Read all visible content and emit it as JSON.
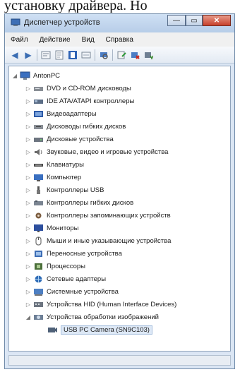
{
  "caption_fragment": "установку драйвера. Но",
  "window": {
    "title": "Диспетчер устройств",
    "controls": {
      "minimize": "—",
      "maximize": "▭",
      "close": "✕"
    }
  },
  "menu": [
    "Файл",
    "Действие",
    "Вид",
    "Справка"
  ],
  "toolbar": {
    "icons": [
      "back-arrow-icon",
      "forward-arrow-icon",
      "device-tree-icon",
      "properties-icon",
      "help-icon",
      "show-hidden-icon",
      "scan-hardware-icon",
      "update-driver-icon",
      "disable-device-icon",
      "uninstall-device-icon"
    ]
  },
  "tree": {
    "root": "AntonPC",
    "items": [
      "DVD и CD-ROM дисководы",
      "IDE ATA/ATAPI контроллеры",
      "Видеоадаптеры",
      "Дисководы гибких дисков",
      "Дисковые устройства",
      "Звуковые, видео и игровые устройства",
      "Клавиатуры",
      "Компьютер",
      "Контроллеры USB",
      "Контроллеры гибких дисков",
      "Контроллеры запоминающих устройств",
      "Мониторы",
      "Мыши и иные указывающие устройства",
      "Переносные устройства",
      "Процессоры",
      "Сетевые адаптеры",
      "Системные устройства",
      "Устройства HID (Human Interface Devices)",
      "Устройства обработки изображений"
    ],
    "child": "USB PC Camera (SN9C103)",
    "colors": {
      "disk": "#8a8f96",
      "drive": "#5b6d86",
      "display": "#2d5aa8",
      "sound": "#6b6b6b",
      "keyboard": "#4a4a4a",
      "computer": "#3a6fc0",
      "usb": "#555555",
      "chip": "#7a5b3e",
      "monitor": "#2d4f9e",
      "mouse": "#555555",
      "portable": "#3c6db5",
      "cpu": "#4b6f3a",
      "network": "#2f6cb6",
      "system": "#4d7fc2",
      "hid": "#6d7580",
      "camera": "#4f6178"
    }
  }
}
